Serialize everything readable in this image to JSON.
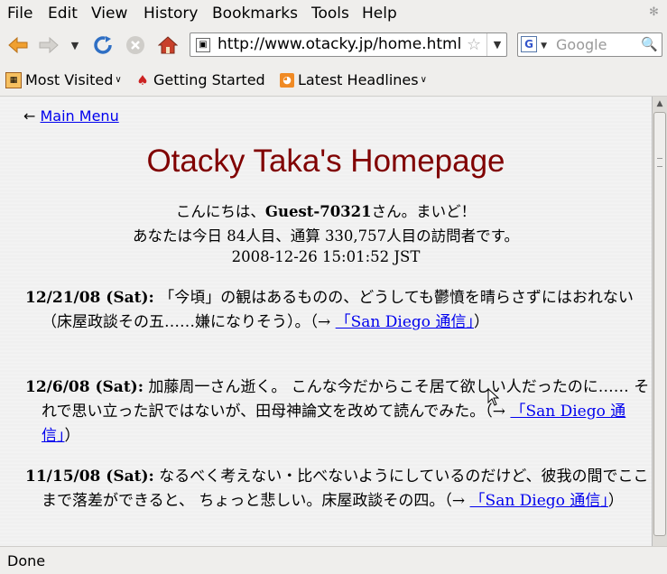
{
  "menubar": {
    "items": [
      {
        "label": "File"
      },
      {
        "label": "Edit"
      },
      {
        "label": "View"
      },
      {
        "label": "History"
      },
      {
        "label": "Bookmarks"
      },
      {
        "label": "Tools"
      },
      {
        "label": "Help"
      }
    ]
  },
  "navbar": {
    "url": "http://www.otacky.jp/home.html",
    "search_placeholder": "Google",
    "search_engine": "G"
  },
  "bookmarks": {
    "items": [
      {
        "label": "Most Visited",
        "icon": "most-visited-icon"
      },
      {
        "label": "Getting Started",
        "icon": "getting-started-icon"
      },
      {
        "label": "Latest Headlines",
        "icon": "rss-icon"
      }
    ]
  },
  "page": {
    "back_arrow": "←",
    "back_link": "Main Menu",
    "title": "Otacky Taka's Homepage",
    "greeting_pre": "こんにちは、",
    "guest_name": "Guest-70321",
    "greeting_post": "さん。まいど！",
    "visitor_line": "あなたは今日 84人目、通算 330,757人目の訪問者です。",
    "datetime": "2008-12-26 15:01:52 JST",
    "entries": [
      {
        "date": "12/21/08 (Sat):",
        "text": "「今頃」の観はあるものの、どうしても鬱憤を晴らさずにはおれない（床屋政談その五……嫌になりそう）。（→",
        "link": "「San Diego 通信」",
        "tail": "）"
      },
      {
        "date": "12/6/08 (Sat):",
        "text": "加藤周一さん逝く。 こんな今だからこそ居て欲しい人だったのに…… それで思い立った訳ではないが、田母神論文を改めて読んでみた。（→",
        "link": "「San Diego 通信」",
        "tail": "）"
      },
      {
        "date": "11/15/08 (Sat):",
        "text": "なるべく考えない・比べないようにしているのだけど、彼我の間でここまで落差ができると、 ちょっと悲しい。床屋政談その四。（→",
        "link": "「San Diego 通信」",
        "tail": "）"
      }
    ]
  },
  "status": {
    "text": "Done"
  },
  "colors": {
    "title": "#800000",
    "link": "#0000ee",
    "chrome": "#efeeec"
  }
}
